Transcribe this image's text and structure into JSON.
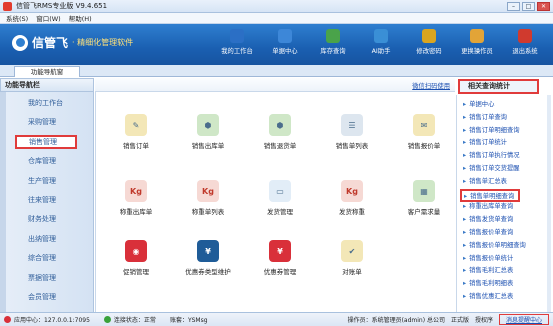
{
  "window": {
    "title": "信管飞RMS专业版 V9.4.651",
    "min": "–",
    "max": "□",
    "close": "✕"
  },
  "menu": [
    "系统(S)",
    "窗口(W)",
    "帮助(H)"
  ],
  "banner": {
    "logo": "信管飞",
    "slogan": "· 精细化管理软件"
  },
  "toolbar": [
    {
      "label": "我的工作台",
      "icon": "monitor-icon",
      "color": "#2b6fc5"
    },
    {
      "label": "单据中心",
      "icon": "document-center-icon",
      "color": "#3d87d8"
    },
    {
      "label": "库存查询",
      "icon": "warehouse-icon",
      "color": "#4aa34a"
    },
    {
      "label": "AI助手",
      "icon": "ai-assistant-icon",
      "color": "#3a8fd6"
    },
    {
      "label": "修改密码",
      "icon": "key-icon",
      "color": "#d9a520"
    },
    {
      "label": "更换操作员",
      "icon": "switch-user-icon",
      "color": "#e2a437"
    },
    {
      "label": "退出系统",
      "icon": "exit-icon",
      "color": "#d03a2e"
    }
  ],
  "tab": {
    "label": "功能导航窗"
  },
  "nav": {
    "title": "功能导航栏",
    "items": [
      {
        "label": "我的工作台",
        "active": false
      },
      {
        "label": "采购管理",
        "active": false
      },
      {
        "label": "销售管理",
        "active": true
      },
      {
        "label": "仓库管理",
        "active": false
      },
      {
        "label": "生产管理",
        "active": false
      },
      {
        "label": "往来管理",
        "active": false
      },
      {
        "label": "财务处理",
        "active": false
      },
      {
        "label": "出纳管理",
        "active": false
      },
      {
        "label": "综合管理",
        "active": false
      },
      {
        "label": "票据管理",
        "active": false
      },
      {
        "label": "会员管理",
        "active": false
      }
    ]
  },
  "main": {
    "link": "微信扫码使用",
    "icons": [
      {
        "label": "销售订单",
        "icon": "sales-order-icon",
        "color": "#f3e7b7",
        "glyph": "✎"
      },
      {
        "label": "销售出库单",
        "icon": "sales-outbound-icon",
        "color": "#cfe7c7",
        "glyph": "⬢"
      },
      {
        "label": "销售退货单",
        "icon": "sales-return-icon",
        "color": "#cfe7c7",
        "glyph": "⬢"
      },
      {
        "label": "销售单列表",
        "icon": "sales-list-icon",
        "color": "#dde6ef",
        "glyph": "☰"
      },
      {
        "label": "销售报价单",
        "icon": "quotation-icon",
        "color": "#f3e7b7",
        "glyph": "✉"
      },
      {
        "label": "称重出库单",
        "icon": "weigh-outbound-icon",
        "color": "#f6d9d4",
        "glyph": "Kg"
      },
      {
        "label": "称重单列表",
        "icon": "weigh-list-icon",
        "color": "#f6d9d4",
        "glyph": "Kg"
      },
      {
        "label": "发货管理",
        "icon": "delivery-icon",
        "color": "#e2edf7",
        "glyph": "▭"
      },
      {
        "label": "发货称重",
        "icon": "delivery-weigh-icon",
        "color": "#f6d9d4",
        "glyph": "Kg"
      },
      {
        "label": "客户需求量",
        "icon": "customer-demand-icon",
        "color": "#cfe7c7",
        "glyph": "▦"
      },
      {
        "label": "促销管理",
        "icon": "promotion-icon",
        "color": "#d9303a",
        "glyph": "◉"
      },
      {
        "label": "优惠券类型维护",
        "icon": "coupon-type-icon",
        "color": "#1f5c98",
        "glyph": "¥"
      },
      {
        "label": "优惠券管理",
        "icon": "coupon-manage-icon",
        "color": "#d9303a",
        "glyph": "¥"
      },
      {
        "label": "对账单",
        "icon": "statement-icon",
        "color": "#f3e7b7",
        "glyph": "✔"
      }
    ]
  },
  "right": {
    "title": "相关查询统计",
    "items": [
      {
        "label": "单据中心",
        "hl": false
      },
      {
        "label": "销售订单查询",
        "hl": false
      },
      {
        "label": "销售订单明细查询",
        "hl": false
      },
      {
        "label": "销售订单统计",
        "hl": false
      },
      {
        "label": "销售订单执行情况",
        "hl": false
      },
      {
        "label": "销售订单交货提醒",
        "hl": false
      },
      {
        "label": "销售单汇总表",
        "hl": false
      },
      {
        "label": "销售单明细查询",
        "hl": true
      },
      {
        "label": "称重出库单查询",
        "hl": false
      },
      {
        "label": "销售发货单查询",
        "hl": false
      },
      {
        "label": "销售报价单查询",
        "hl": false
      },
      {
        "label": "销售报价单明细查询",
        "hl": false
      },
      {
        "label": "销售报价单统计",
        "hl": false
      },
      {
        "label": "销售毛利汇总表",
        "hl": false
      },
      {
        "label": "销售毛利明细表",
        "hl": false
      },
      {
        "label": "销售优惠汇总表",
        "hl": false
      }
    ]
  },
  "status": {
    "server": "应用中心：127.0.0.1:7095",
    "conn": "连接状态：正常",
    "book": "账套：YSMsg",
    "operator": "操作员：系统管理员(admin) 总公司",
    "edition": "正式版",
    "license": "授权序",
    "help": "消息提醒中心"
  }
}
